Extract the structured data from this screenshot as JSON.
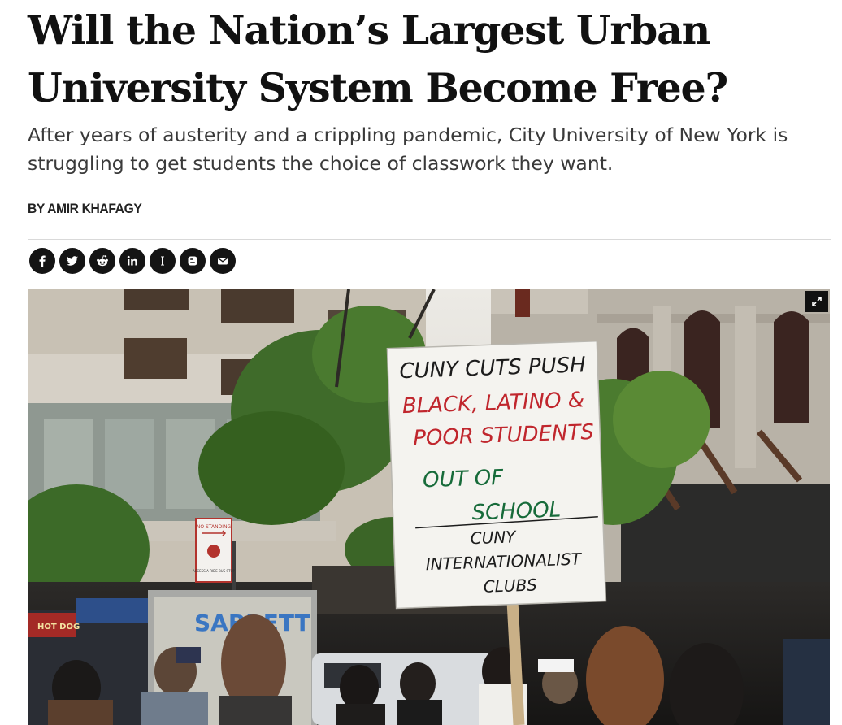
{
  "article": {
    "headline": "Will the Nation’s Largest Urban University System Become Free?",
    "dek": "After years of austerity and a crippling pandemic, City University of New York is struggling to get students the choice of classwork they want.",
    "byline": "BY AMIR KHAFAGY"
  },
  "share_icons": [
    "facebook-icon",
    "twitter-icon",
    "reddit-icon",
    "linkedin-icon",
    "instapaper-icon",
    "blogger-icon",
    "email-icon"
  ],
  "photo": {
    "sign_lines": [
      "CUNY CUTS PUSH",
      "BLACK, LATINO &",
      "POOR STUDENTS",
      "OUT OF",
      "SCHOOL",
      "CUNY",
      "INTERNATIONALIST",
      "CLUBS"
    ],
    "street_sign_top": "NO STANDING",
    "street_sign_bottom": "ACCESS-A-RIDE BUS STOP",
    "cart_brand": "SABRETT",
    "cart_label": "HOT DOG",
    "colors": {
      "sign_black": "#1c1c1c",
      "sign_red": "#c0262d",
      "sign_green": "#176b3a"
    }
  }
}
